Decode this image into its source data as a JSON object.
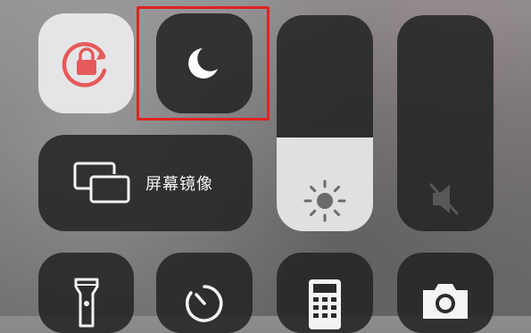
{
  "screen": "control-center",
  "tiles": {
    "rotation_lock": {
      "icon": "rotation-lock-icon",
      "state": "on",
      "accent": "#e55a5a"
    },
    "do_not_disturb": {
      "icon": "moon-icon",
      "state": "off",
      "highlighted": true,
      "highlight_color": "#e02323"
    },
    "screen_mirroring": {
      "label": "屏幕镜像",
      "icon": "screen-mirroring-icon"
    },
    "brightness": {
      "icon": "sun-icon",
      "level": 0.46
    },
    "volume": {
      "icon": "speaker-muted-icon",
      "level": 0.0
    },
    "flashlight": {
      "icon": "flashlight-icon"
    },
    "timer": {
      "icon": "timer-icon"
    },
    "calculator": {
      "icon": "calculator-icon"
    },
    "camera": {
      "icon": "camera-icon"
    }
  }
}
